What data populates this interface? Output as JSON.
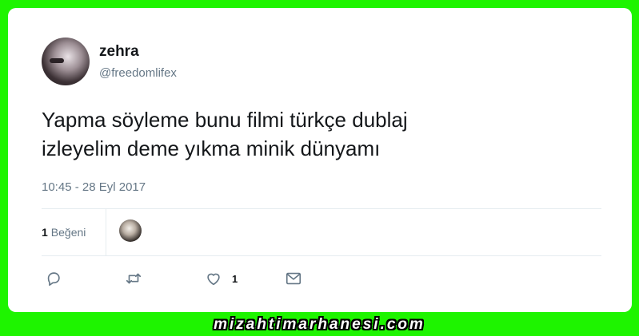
{
  "tweet": {
    "author_name": "zehra",
    "author_handle": "@freedomlifex",
    "text_line1": "Yapma söyleme bunu filmi türkçe dublaj",
    "text_line2": "izleyelim deme yıkma minik dünyamı",
    "timestamp": "10:45 - 28 Eyl 2017"
  },
  "stats": {
    "likes_count": "1",
    "likes_label": "Beğeni"
  },
  "actions": {
    "reply_icon": "reply-icon",
    "retweet_icon": "retweet-icon",
    "like_icon": "heart-icon",
    "like_count": "1",
    "message_icon": "envelope-icon"
  },
  "watermark": "mizahtimarhanesi.com",
  "colors": {
    "background": "#1ef400",
    "card": "#ffffff",
    "text_primary": "#14171a",
    "text_secondary": "#657786"
  }
}
